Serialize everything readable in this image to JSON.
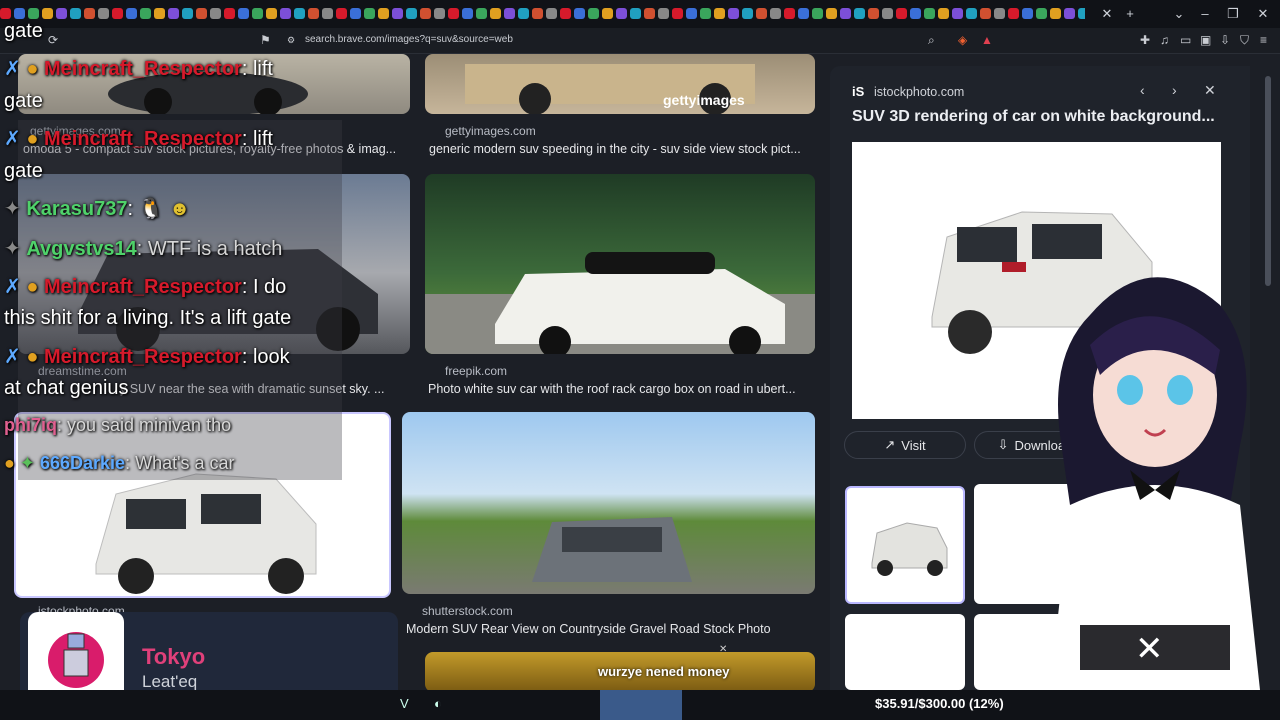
{
  "browser": {
    "url": "search.brave.com/images?q=suv&source=web",
    "tab_colors": [
      "#d61a2b",
      "#3a6fd8",
      "#3aa55c",
      "#e0a020",
      "#7c4fd8",
      "#20a0c0",
      "#d05030",
      "#888888"
    ]
  },
  "results": [
    {
      "source": "gettyimages.com",
      "title": "omoda 5 - compact suv stock pictures, royalty-free photos & imag..."
    },
    {
      "source": "gettyimages.com",
      "title": "generic modern suv speeding in the city - suv side view stock pict..."
    },
    {
      "source": "dreamstime.com",
      "title": "y SUV near the sea with dramatic sunset sky. ..."
    },
    {
      "source": "freepik.com",
      "title": "Photo white suv car with the roof rack cargo box on road in ubert..."
    },
    {
      "source": "istockphoto.com",
      "title": ""
    },
    {
      "source": "shutterstock.com",
      "title": "Modern SUV Rear View on Countryside Gravel Road Stock Photo"
    }
  ],
  "watermark": "gettyimages",
  "panel": {
    "source": "istockphoto.com",
    "title": "SUV 3D rendering of car on white background...",
    "visit_label": "Visit",
    "download_label": "Download"
  },
  "chat": {
    "lines": [
      {
        "user": "Meincraft_Respector",
        "msg": ": lift"
      },
      {
        "user": "",
        "msg": "gate"
      },
      {
        "user": "Meincraft_Respector",
        "msg": ": lift"
      },
      {
        "user": "",
        "msg": "gate"
      },
      {
        "user": "Karasu737",
        "msg": ":"
      },
      {
        "user": "Avgvstvs14",
        "msg": ": WTF is a hatch"
      },
      {
        "user": "Meincraft_Respector",
        "msg": ": I do"
      },
      {
        "user": "",
        "msg": "this shit for a living. It's a lift gate"
      },
      {
        "user": "Meincraft_Respector",
        "msg": ": look"
      },
      {
        "user": "",
        "msg": "at chat genius"
      },
      {
        "user": "phi7iq",
        "msg": ": you said minivan tho"
      },
      {
        "user": "666Darkie",
        "msg": ": What's a car"
      }
    ],
    "top_fragment": "gate"
  },
  "overlay": {
    "donation_note": "wurzye nened money",
    "goal": "$35.91/$300.00 (12%)",
    "goal_fraction": 0.12
  },
  "now_playing": {
    "title": "Tokyo",
    "artist": "Leat'eq"
  }
}
